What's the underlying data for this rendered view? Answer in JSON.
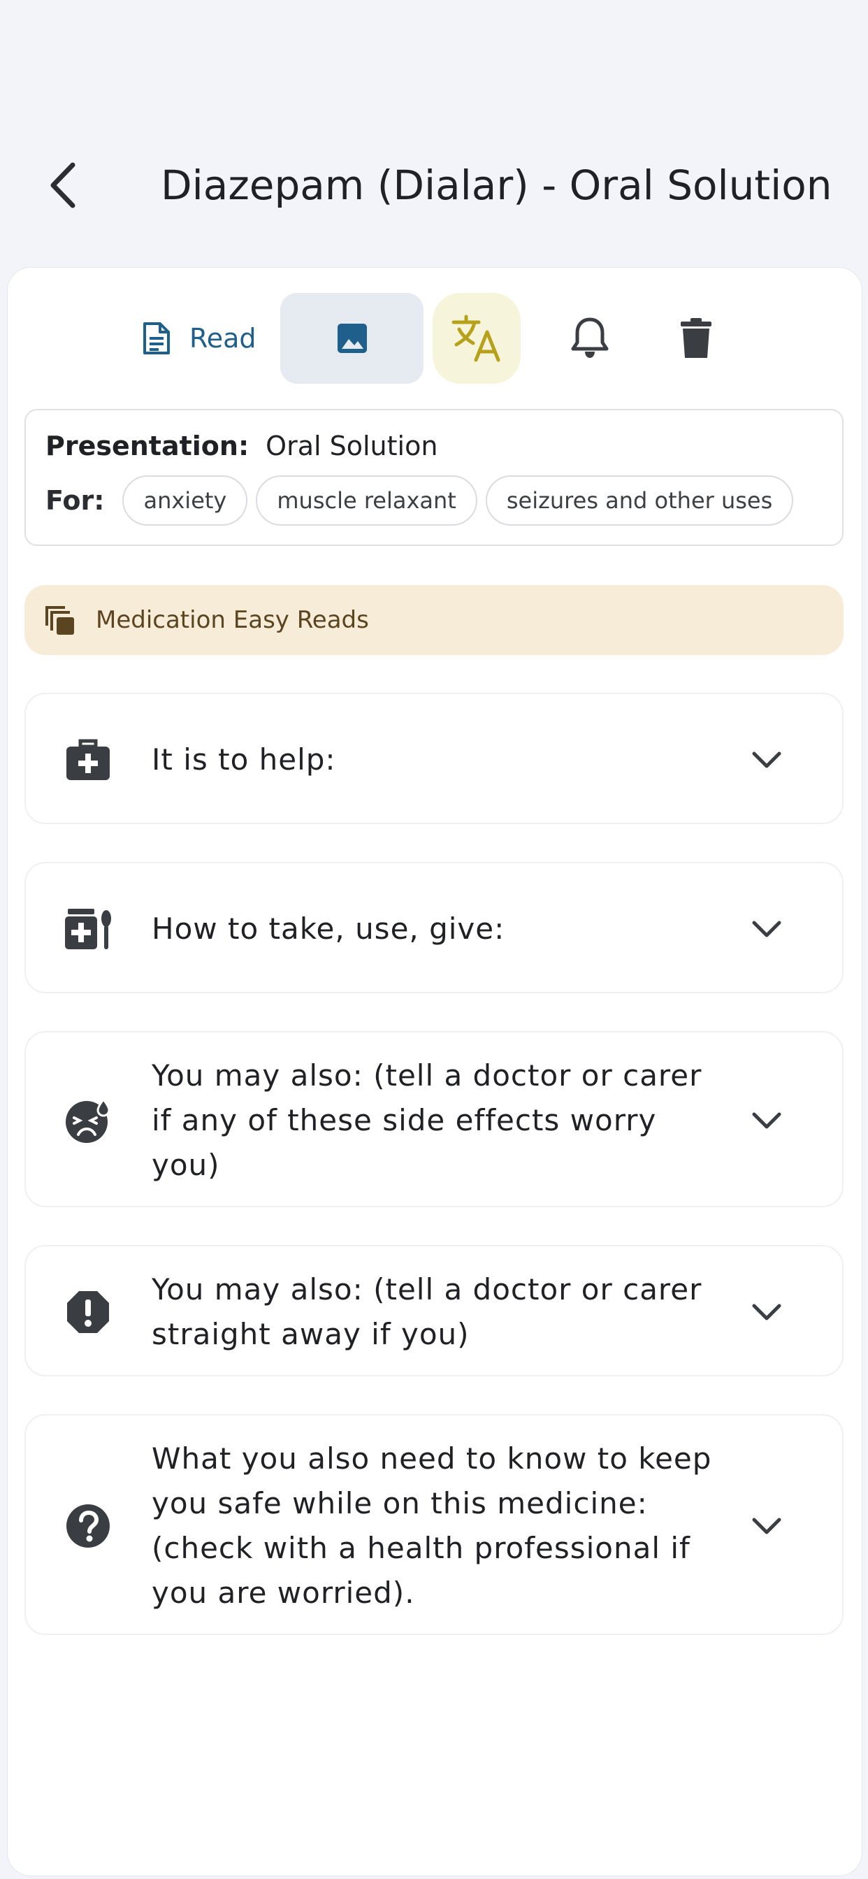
{
  "header": {
    "title": "Diazepam (Dialar) - Oral Solution ...",
    "back_icon": "chevron-left-icon"
  },
  "toolbar": {
    "read_label": "Read",
    "read_icon": "document-icon",
    "image_icon": "image-icon",
    "translate_icon": "translate-icon",
    "bell_icon": "bell-icon",
    "trash_icon": "trash-icon",
    "colors": {
      "read": "#1f5f8b",
      "translate": "#b5a21a",
      "dark": "#3a3d42"
    }
  },
  "info": {
    "presentation_label": "Presentation:",
    "presentation_value": "Oral Solution",
    "for_label": "For:",
    "chips": [
      "anxiety",
      "muscle relaxant",
      "seizures and other uses"
    ]
  },
  "banner": {
    "text": "Medication Easy Reads",
    "icon": "copy-icon",
    "background": "#f7ecd8"
  },
  "sections": [
    {
      "icon": "medical-kit-icon",
      "text": "It is to help:"
    },
    {
      "icon": "medicine-spoon-icon",
      "text": "How to take, use, give:"
    },
    {
      "icon": "sad-face-icon",
      "text": "You may also: (tell a doctor or carer if any of these side effects worry you)"
    },
    {
      "icon": "exclamation-icon",
      "text": "You may also: (tell a doctor or carer straight away if you)"
    },
    {
      "icon": "question-icon",
      "text": "What you also need to know to keep you safe while on this medicine: (check with a health professional if you are worried)."
    }
  ]
}
